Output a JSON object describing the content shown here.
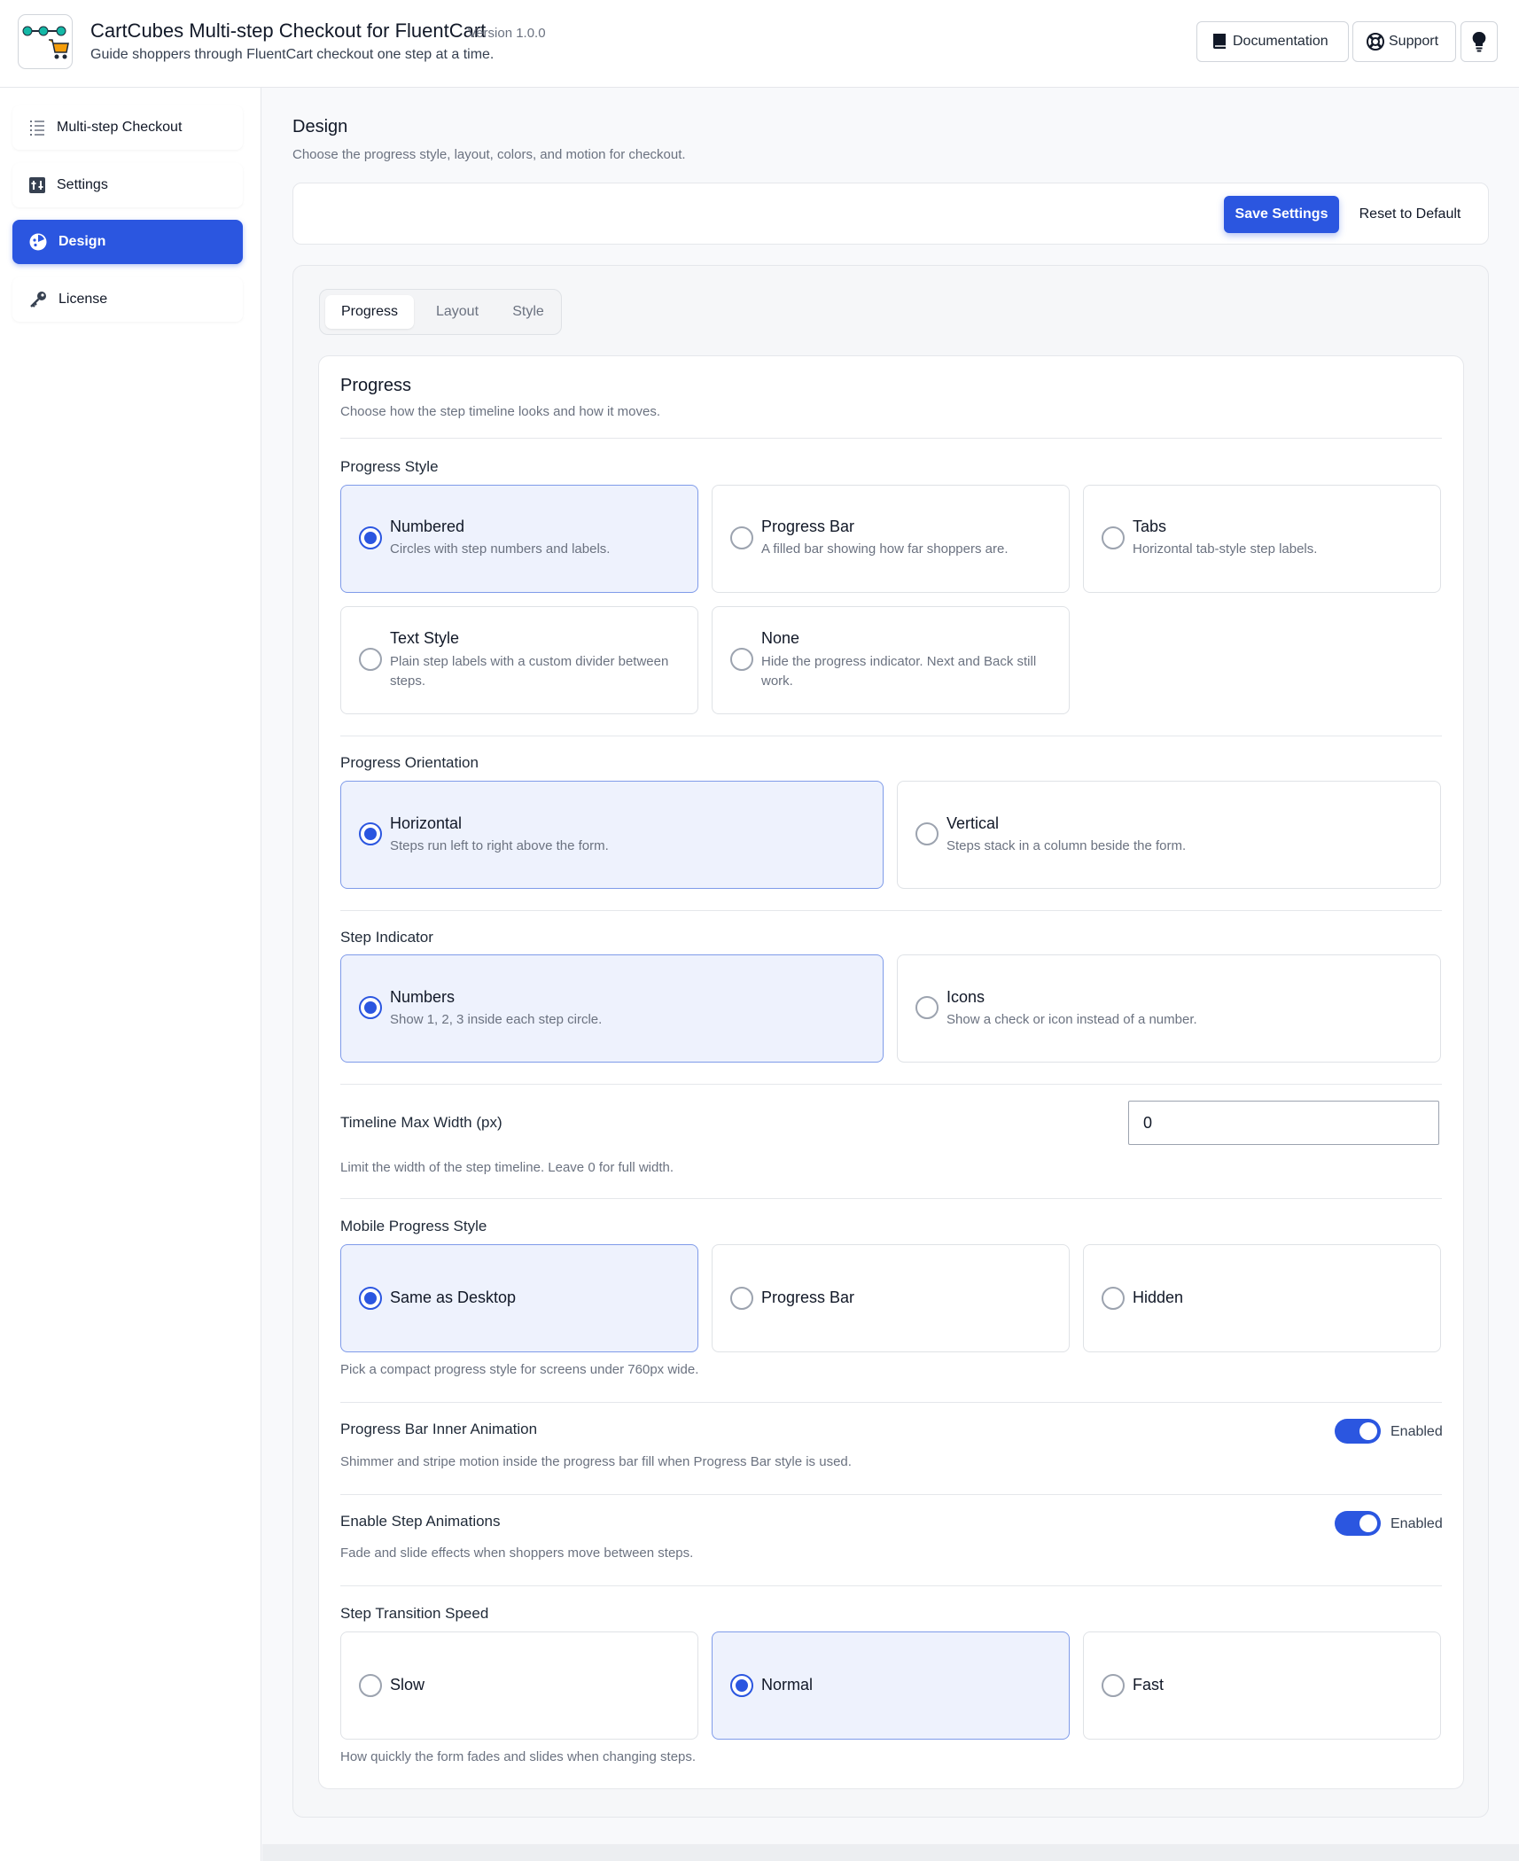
{
  "app": {
    "title": "CartCubes Multi-step Checkout for FluentCart",
    "version": "Version 1.0.0",
    "subtitle": "Guide shoppers through FluentCart checkout one step at a time."
  },
  "header_buttons": {
    "documentation": "Documentation",
    "support": "Support",
    "bulb_icon": "lightbulb-icon"
  },
  "sidebar": {
    "items": [
      {
        "label": "Multi-step Checkout",
        "icon": "list-icon",
        "active": false
      },
      {
        "label": "Settings",
        "icon": "sliders-icon",
        "active": false
      },
      {
        "label": "Design",
        "icon": "palette-icon",
        "active": true
      },
      {
        "label": "License",
        "icon": "key-icon",
        "active": false
      }
    ]
  },
  "page": {
    "title": "Design",
    "description": "Choose the progress style, layout, colors, and motion for checkout."
  },
  "actions": {
    "save": "Save Settings",
    "reset": "Reset to Default"
  },
  "tabs": [
    {
      "label": "Progress",
      "active": true
    },
    {
      "label": "Layout",
      "active": false
    },
    {
      "label": "Style",
      "active": false
    }
  ],
  "section": {
    "title": "Progress",
    "description": "Choose how the step timeline looks and how it moves."
  },
  "progress_style": {
    "label": "Progress Style",
    "options": [
      {
        "title": "Numbered",
        "desc": "Circles with step numbers and labels.",
        "selected": true
      },
      {
        "title": "Progress Bar",
        "desc": "A filled bar showing how far shoppers are.",
        "selected": false
      },
      {
        "title": "Tabs",
        "desc": "Horizontal tab-style step labels.",
        "selected": false
      },
      {
        "title": "Text Style",
        "desc": "Plain step labels with a custom divider between steps.",
        "selected": false
      },
      {
        "title": "None",
        "desc": "Hide the progress indicator. Next and Back still work.",
        "selected": false
      }
    ]
  },
  "orientation": {
    "label": "Progress Orientation",
    "options": [
      {
        "title": "Horizontal",
        "desc": "Steps run left to right above the form.",
        "selected": true
      },
      {
        "title": "Vertical",
        "desc": "Steps stack in a column beside the form.",
        "selected": false
      }
    ]
  },
  "step_indicator": {
    "label": "Step Indicator",
    "options": [
      {
        "title": "Numbers",
        "desc": "Show 1, 2, 3 inside each step circle.",
        "selected": true
      },
      {
        "title": "Icons",
        "desc": "Show a check or icon instead of a number.",
        "selected": false
      }
    ]
  },
  "timeline_width": {
    "label": "Timeline Max Width (px)",
    "value": "0",
    "help": "Limit the width of the step timeline. Leave 0 for full width."
  },
  "mobile_style": {
    "label": "Mobile Progress Style",
    "options": [
      {
        "title": "Same as Desktop",
        "selected": true
      },
      {
        "title": "Progress Bar",
        "selected": false
      },
      {
        "title": "Hidden",
        "selected": false
      }
    ],
    "help": "Pick a compact progress style for screens under 760px wide."
  },
  "inner_animation": {
    "label": "Progress Bar Inner Animation",
    "state": "Enabled",
    "enabled": true,
    "help": "Shimmer and stripe motion inside the progress bar fill when Progress Bar style is used."
  },
  "step_animations": {
    "label": "Enable Step Animations",
    "state": "Enabled",
    "enabled": true,
    "help": "Fade and slide effects when shoppers move between steps."
  },
  "transition_speed": {
    "label": "Step Transition Speed",
    "options": [
      {
        "title": "Slow",
        "selected": false
      },
      {
        "title": "Normal",
        "selected": true
      },
      {
        "title": "Fast",
        "selected": false
      }
    ],
    "help": "How quickly the form fades and slides when changing steps."
  },
  "colors": {
    "accent": "#2b56e0",
    "selected_card_bg": "#eef2fd"
  }
}
